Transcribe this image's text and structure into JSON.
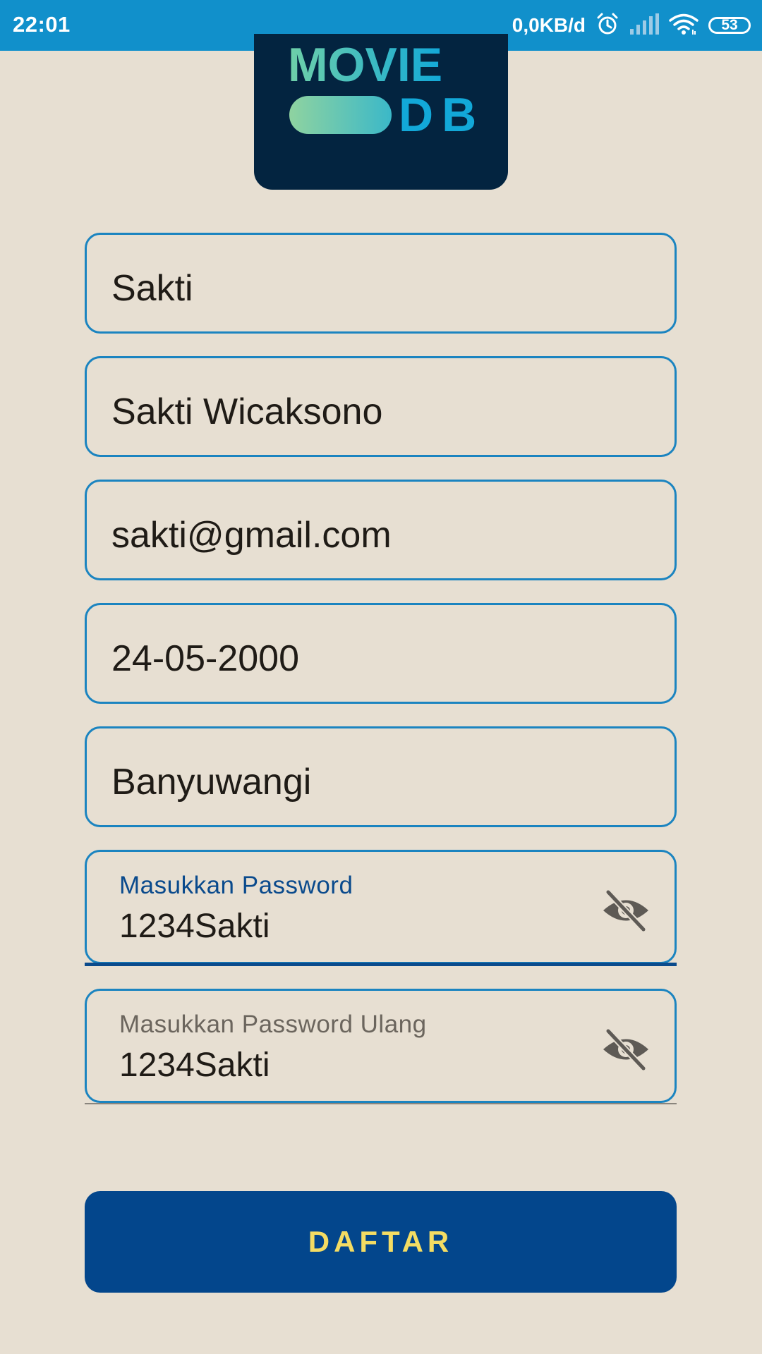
{
  "status_bar": {
    "time": "22:01",
    "network_speed": "0,0KB/d",
    "battery": "53"
  },
  "logo": {
    "line1": "MOVIE",
    "line2": "DB"
  },
  "form": {
    "username_value": "Sakti",
    "fullname_value": "Sakti Wicaksono",
    "email_value": "sakti@gmail.com",
    "birthdate_value": "24-05-2000",
    "city_value": "Banyuwangi",
    "password_label": "Masukkan Password",
    "password_value": "1234Sakti",
    "confirm_password_label": "Masukkan Password Ulang",
    "confirm_password_value": "1234Sakti"
  },
  "submit_button": {
    "label": "DAFTAR"
  },
  "colors": {
    "background": "#e7dfd2",
    "status_bar": "#1190cb",
    "field_border": "#1b84c0",
    "focus_label": "#0a4a8c",
    "button_bg": "#03468c",
    "button_text": "#f4dc63",
    "logo_bg": "#032440"
  },
  "icons": {
    "alarm": "alarm-icon",
    "signal": "signal-icon",
    "wifi": "wifi-icon",
    "battery": "battery-icon",
    "password_toggle": "eye-off-icon"
  }
}
